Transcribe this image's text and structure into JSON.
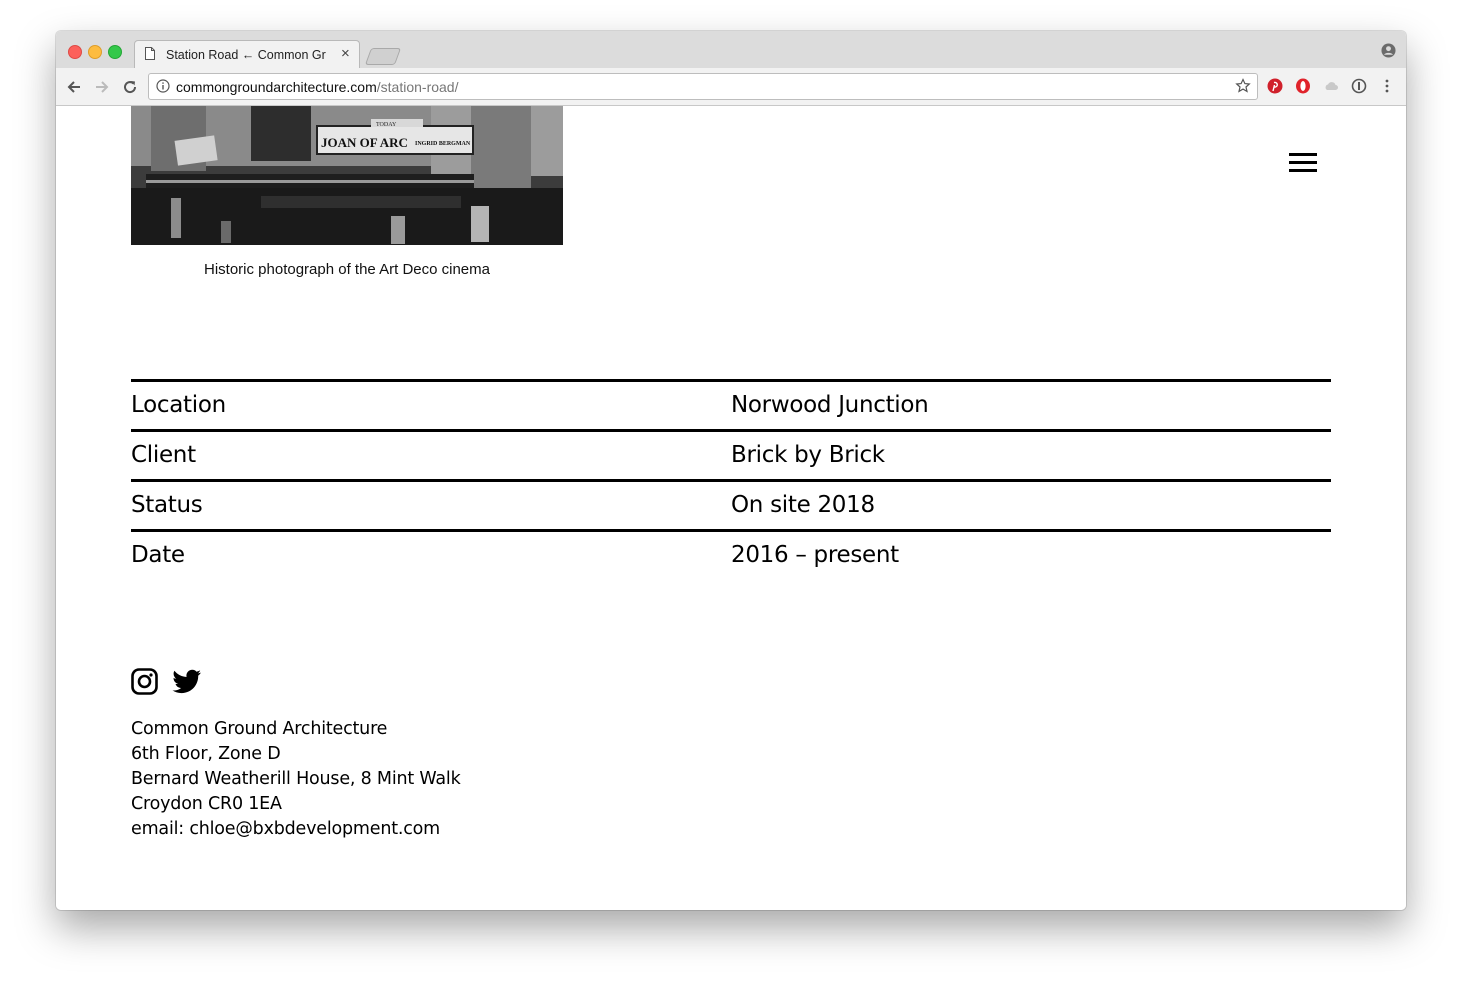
{
  "browser": {
    "tab_title": "Station Road ← Common Gro",
    "tab_close": "×",
    "url_host": "commongroundarchitecture.com",
    "url_path": "/station-road/"
  },
  "page": {
    "photo": {
      "marquee_main": "JOAN OF ARC",
      "marquee_side": "INGRID BERGMAN",
      "marquee_top": "TODAY"
    },
    "caption": "Historic photograph of the Art Deco cinema",
    "facts": [
      {
        "label": "Location",
        "value": "Norwood Junction"
      },
      {
        "label": "Client",
        "value": "Brick by Brick"
      },
      {
        "label": "Status",
        "value": "On site 2018"
      },
      {
        "label": "Date",
        "value": "2016 – present"
      }
    ],
    "footer": {
      "social": [
        "instagram-icon",
        "twitter-icon"
      ],
      "address_lines": [
        "Common Ground Architecture",
        "6th Floor, Zone D",
        "Bernard Weatherill House, 8 Mint Walk",
        "Croydon CR0 1EA",
        "email: chloe@bxbdevelopment.com"
      ]
    }
  },
  "colors": {
    "text": "#000000",
    "tabbar": "#dcdcdc",
    "toolbar": "#f2f2f2"
  }
}
